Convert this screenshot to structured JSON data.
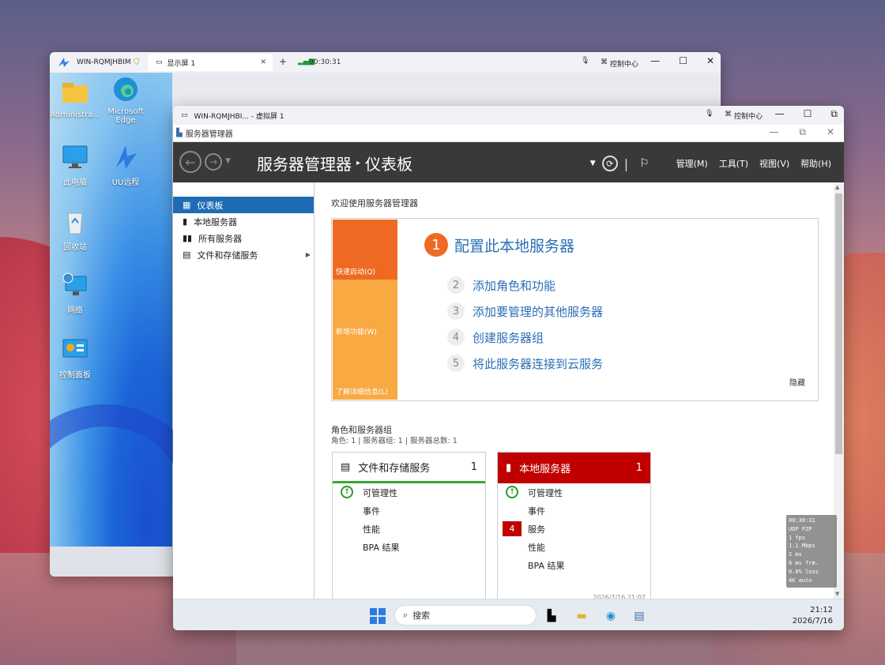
{
  "outer_window": {
    "host": "WIN-RQMJHBIM",
    "tab_label": "显示屏 1",
    "add_tab": "+",
    "timer": "00:30:31",
    "control_center": "控制中心",
    "btn_min": "—",
    "btn_max": "☐",
    "btn_close": "✕"
  },
  "desktop_icons": [
    {
      "label": "Administra..."
    },
    {
      "label": "Microsoft Edge"
    },
    {
      "label": "此电脑"
    },
    {
      "label": "UU远程"
    },
    {
      "label": "回收站"
    },
    {
      "label": "网络"
    },
    {
      "label": "控制面板"
    }
  ],
  "inner_window": {
    "title": "WIN-RQMJHBI... - 虚拟屏 1",
    "control_center": "控制中心"
  },
  "server_manager": {
    "app_title": "服务器管理器",
    "crumb_root": "服务器管理器",
    "crumb_sep": "▸",
    "crumb_page": "仪表板",
    "menus": [
      "管理(M)",
      "工具(T)",
      "视图(V)",
      "帮助(H)"
    ],
    "sidebar": [
      {
        "label": "仪表板",
        "active": true
      },
      {
        "label": "本地服务器",
        "active": false
      },
      {
        "label": "所有服务器",
        "active": false
      },
      {
        "label": "文件和存储服务",
        "active": false
      }
    ],
    "welcome_title": "欢迎使用服务器管理器",
    "tiles": [
      "快速启动(Q)",
      "新增功能(W)",
      "了解详细信息(L)"
    ],
    "steps": [
      {
        "num": "1",
        "text": "配置此本地服务器"
      },
      {
        "num": "2",
        "text": "添加角色和功能"
      },
      {
        "num": "3",
        "text": "添加要管理的其他服务器"
      },
      {
        "num": "4",
        "text": "创建服务器组"
      },
      {
        "num": "5",
        "text": "将此服务器连接到云服务"
      }
    ],
    "hide": "隐藏",
    "roles_title": "角色和服务器组",
    "roles_sub": "角色: 1 | 服务器组: 1 | 服务器总数: 1",
    "cards": [
      {
        "title": "文件和存储服务",
        "count": "1",
        "rows": [
          "可管理性",
          "事件",
          "性能",
          "BPA 结果"
        ]
      },
      {
        "title": "本地服务器",
        "count": "1",
        "rows": [
          "可管理性",
          "事件",
          "服务",
          "性能",
          "BPA 结果"
        ],
        "services_badge": "4",
        "timestamp": "2026/7/16 21:07"
      }
    ]
  },
  "taskbar": {
    "search_placeholder": "搜索",
    "time": "21:12",
    "date": "2026/7/16"
  },
  "stats": [
    "00:30:31",
    "UDP P2P",
    "1 fps",
    "1.1 Mbps",
    "2 ms",
    "6 ms frm.",
    "0.0% loss",
    "4K auto"
  ],
  "colors": {
    "accent_blue": "#1f6cb5",
    "quick_start_orange": "#ee6a22",
    "tile_orange": "#f9a942",
    "header_dark": "#393939",
    "alert_red": "#c00000",
    "ok_green": "#38a738"
  }
}
